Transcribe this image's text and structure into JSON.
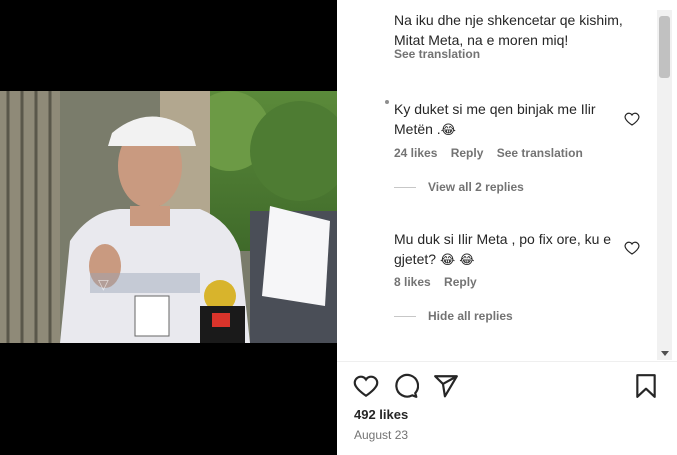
{
  "post": {
    "media": {
      "watermark": "▽"
    },
    "comments": [
      {
        "text": "Na iku dhe nje shkencetar qe kishim,\nMitat Meta, na e moren miq!",
        "see_translation": "See translation"
      },
      {
        "text": "Ky duket si me qen binjak me Ilir\nMetën .",
        "emoji": "😂",
        "likes": "24 likes",
        "reply": "Reply",
        "see_translation": "See translation",
        "view_replies": "View all 2 replies"
      },
      {
        "text": "Mu duk si Ilir Meta , po fix ore, ku e\ngjetet?",
        "emoji": "😂 😂",
        "likes": "8 likes",
        "reply": "Reply",
        "hide_replies": "Hide all replies"
      }
    ],
    "likes": "492 likes",
    "date": "August 23"
  },
  "icons": {
    "like": "heart-icon",
    "comment": "comment-icon",
    "share": "share-icon",
    "save": "bookmark-icon"
  }
}
